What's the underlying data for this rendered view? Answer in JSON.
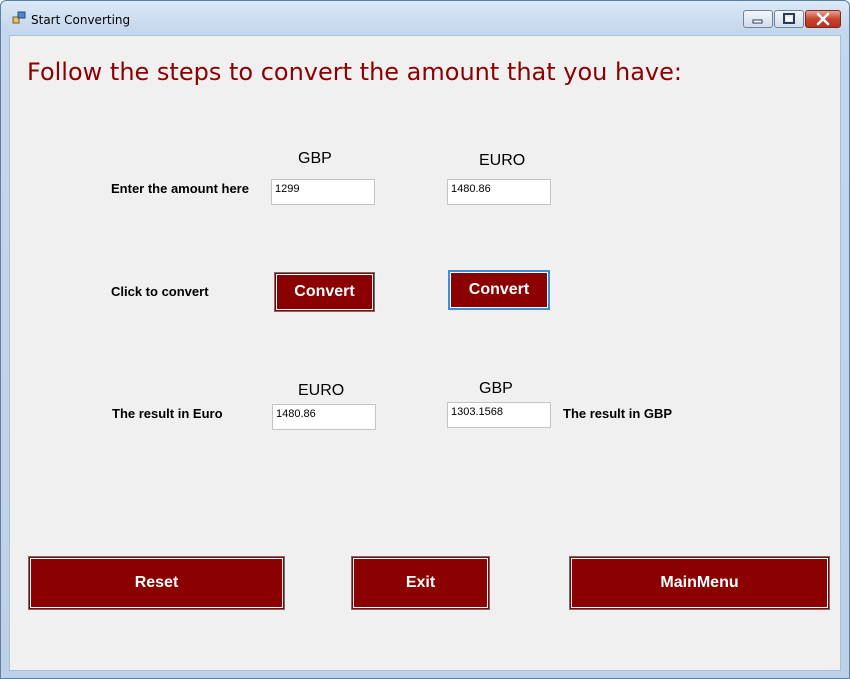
{
  "window": {
    "title": "Start Converting"
  },
  "heading": "Follow the steps to convert the amount that you have:",
  "input_row": {
    "label": "Enter the amount here",
    "gbp_header": "GBP",
    "euro_header": "EURO",
    "gbp_value": "1299",
    "euro_value": "1480.86"
  },
  "convert_row": {
    "label": "Click to convert",
    "convert_gbp_label": "Convert",
    "convert_euro_label": "Convert"
  },
  "result_row": {
    "euro_header": "EURO",
    "gbp_header": "GBP",
    "label_euro": "The result in Euro",
    "label_gbp": "The result in GBP",
    "euro_value": "1480.86",
    "gbp_value": "1303.1568"
  },
  "buttons": {
    "reset": "Reset",
    "exit": "Exit",
    "mainmenu": "MainMenu"
  },
  "colors": {
    "accent": "#8b0000",
    "heading": "#8b0000"
  }
}
